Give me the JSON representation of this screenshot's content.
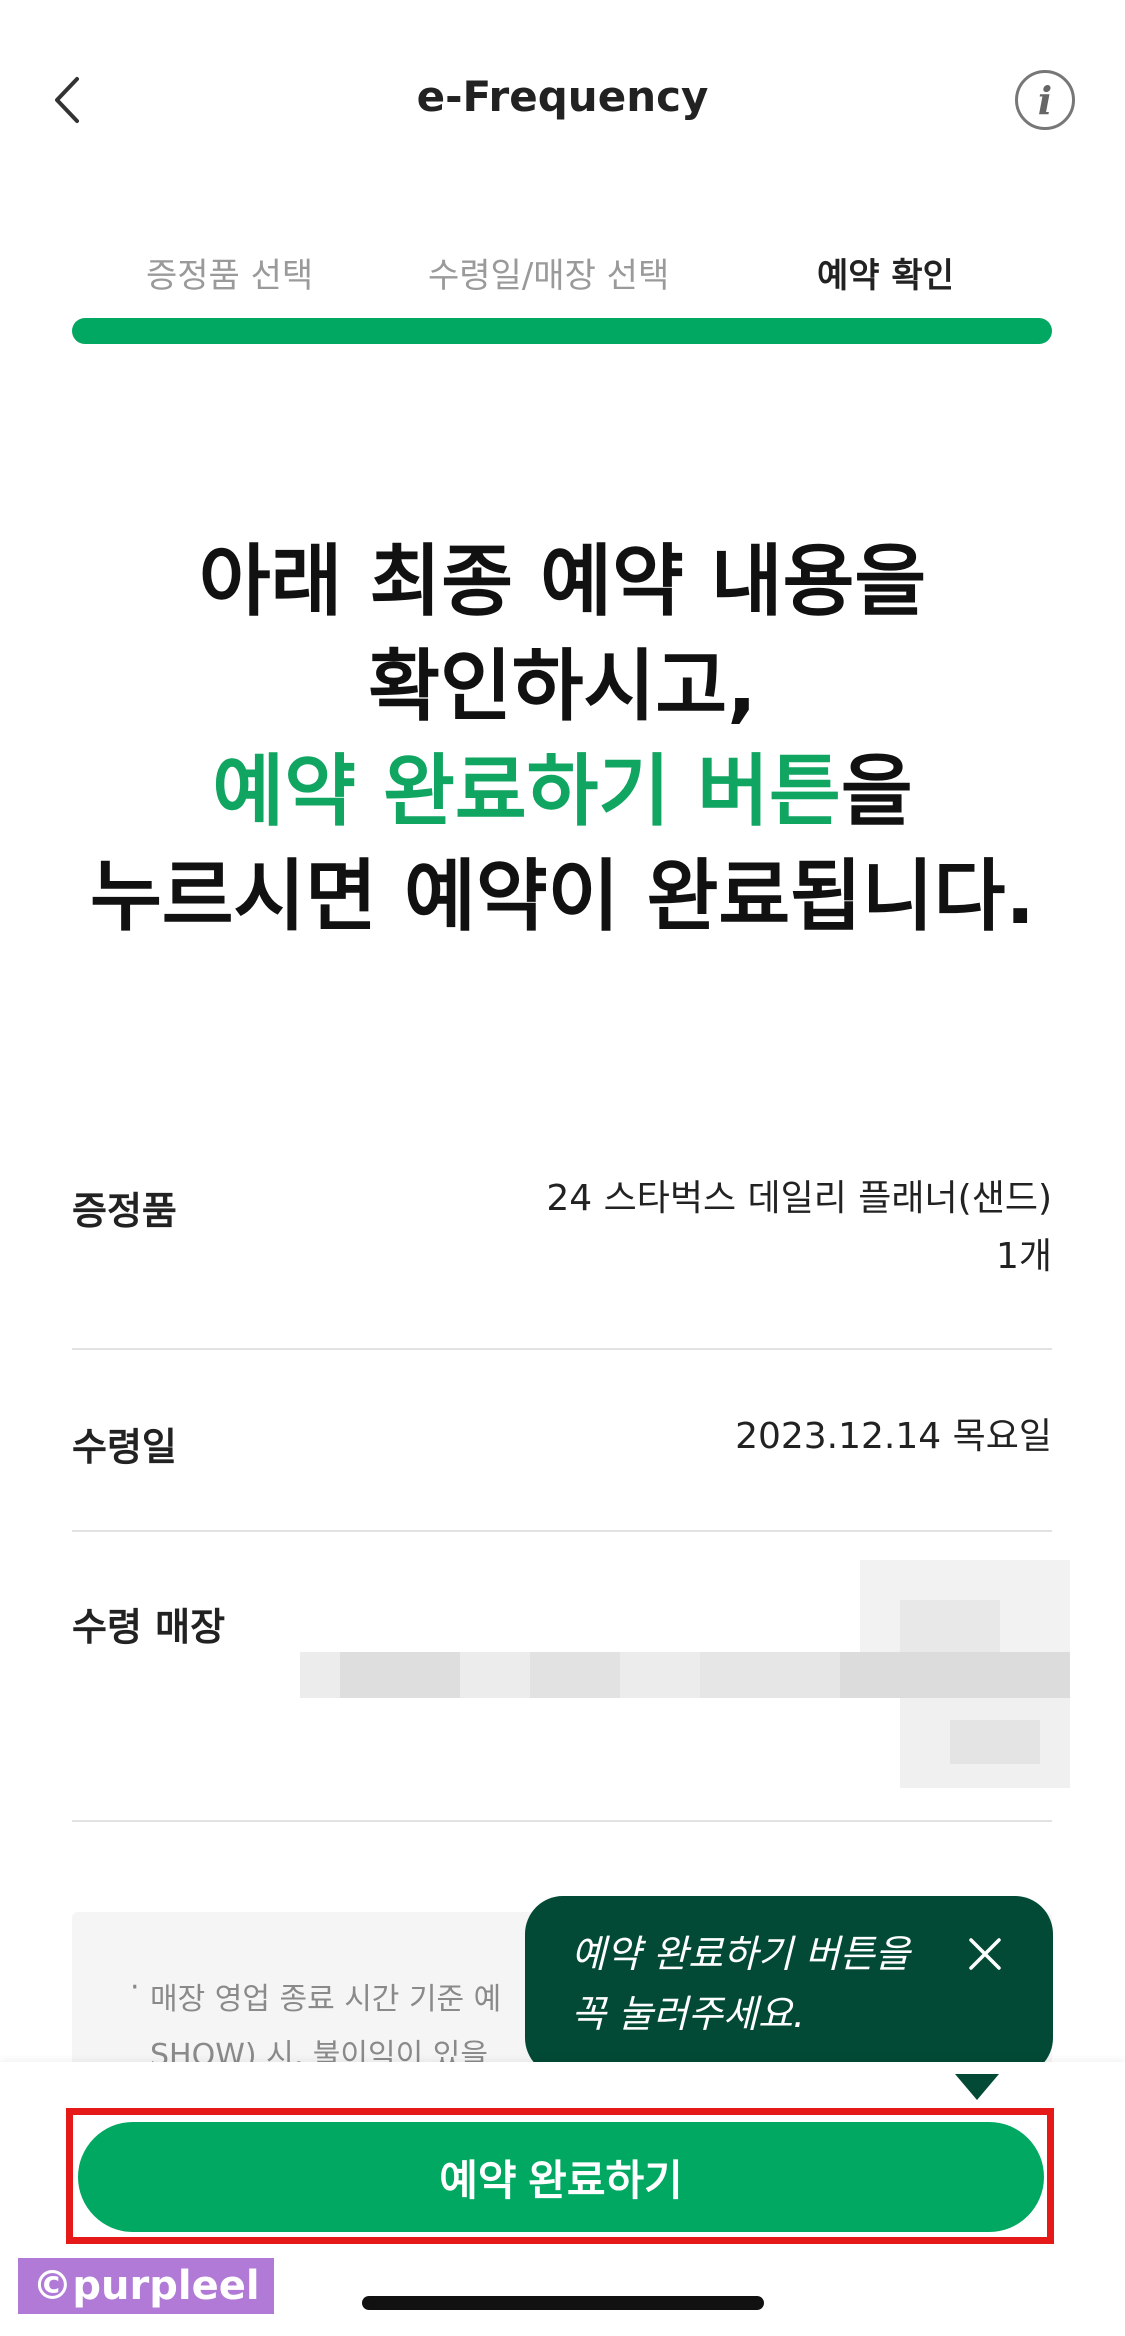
{
  "header": {
    "title": "e-Frequency",
    "info_glyph": "i"
  },
  "steps": [
    {
      "label": "증정품 선택",
      "active": false
    },
    {
      "label": "수령일/매장 선택",
      "active": false
    },
    {
      "label": "예약 확인",
      "active": true
    }
  ],
  "progress": 1.0,
  "headline": {
    "line1": "아래 최종 예약 내용을",
    "line2": "확인하시고,",
    "line3_accent": "예약 완료하기 버튼",
    "line3_rest": "을",
    "line4": "누르시면 예약이 완료됩니다."
  },
  "details": {
    "gift_label": "증정품",
    "gift_value_line1": "24 스타벅스 데일리 플래너(샌드)",
    "gift_value_line2": "1개",
    "date_label": "수령일",
    "date_value": "2023.12.14 목요일",
    "store_label": "수령 매장"
  },
  "notice": {
    "bullet": "·",
    "line1": "매장 영업 종료 시간 기준 예",
    "line2": "SHOW) 시, 불이익이 있을"
  },
  "tooltip": {
    "line1": "예약 완료하기 버튼을",
    "line2": "꼭 눌러주세요."
  },
  "bottom": {
    "complete_label": "예약 완료하기"
  },
  "watermark": "©purpleel",
  "colors": {
    "accent": "#00a862",
    "tooltip_bg": "#024a36",
    "highlight": "#e61919"
  }
}
